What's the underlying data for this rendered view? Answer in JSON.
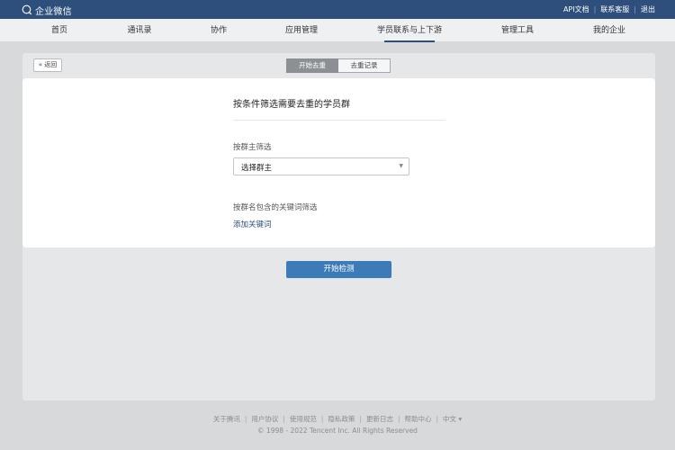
{
  "app": {
    "logo_text": "企业微信"
  },
  "top_links": [
    "API文档",
    "联系客服",
    "退出"
  ],
  "nav": {
    "items": [
      "首页",
      "通讯录",
      "协作",
      "应用管理",
      "学员联系与上下游",
      "管理工具",
      "我的企业"
    ],
    "active": "学员联系与上下游"
  },
  "panel": {
    "back_label": "« 返回",
    "tabs": [
      "开始去重",
      "去重记录"
    ],
    "active_tab": "开始去重"
  },
  "form": {
    "title": "按条件筛选需要去重的学员群",
    "owner_label": "按群主筛选",
    "owner_select_value": "选择群主",
    "keyword_label": "按群名包含的关键词筛选",
    "add_keyword_label": "添加关键词",
    "start_button": "开始检测"
  },
  "footer": {
    "links": [
      "关于腾讯",
      "用户协议",
      "使用规范",
      "隐私政策",
      "更新日志",
      "帮助中心",
      "中文 ▾"
    ],
    "copyright": "© 1998 - 2022 Tencent Inc. All Rights Reserved"
  },
  "colors": {
    "topbar": "#2e4f7b",
    "primary_button": "#3d7ab8",
    "page_bg": "#d7d9db"
  }
}
